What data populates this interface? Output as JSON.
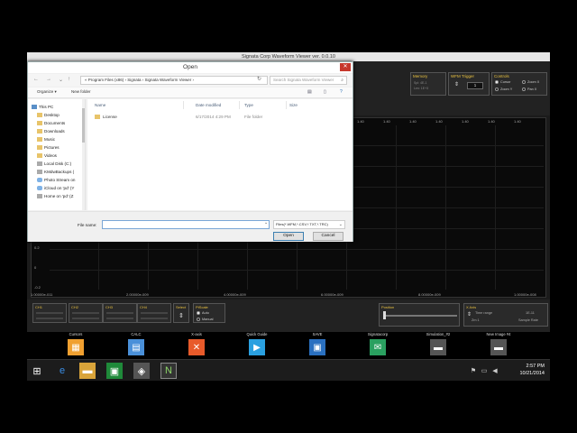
{
  "app": {
    "title": "Signata Corp Waveform Viewer ver. 0.0.10",
    "memory": {
      "title": "Memory",
      "line1": "Spl: 4E-1",
      "line2": "Len: 1E+3"
    },
    "wfm_trigger": {
      "title": "WFM Trigger",
      "value": "1"
    },
    "controls": {
      "title": "Controls",
      "opt1": "Cursor",
      "opt2": "Zoom X",
      "opt3": "Zoom Y",
      "opt4": "Pan X"
    },
    "plot": {
      "top_ticks": [
        "1.40",
        "1.40",
        "1.40",
        "1.40",
        "1.40",
        "1.40",
        "1.40"
      ],
      "bottom_ticks": [
        "1.00000e-011",
        "2.00000e-009",
        "4.00000e-009",
        "6.00000e-009",
        "8.00000e-009",
        "1.00000e-008"
      ],
      "yticks": [
        "0.2",
        "0",
        "-0.2"
      ]
    },
    "channels": [
      "CH1",
      "CH2",
      "CH3",
      "CH4"
    ],
    "select_label": "Select",
    "ptscale": {
      "title": "PtScale",
      "auto": "Auto",
      "manual": "Manual"
    },
    "position_label": "Position",
    "xaxis": {
      "title": "X Axis",
      "time_range": "Time range",
      "time_range_val": "1E-11",
      "sample_rate": "Sample Rate",
      "zoom": "Zm 1"
    }
  },
  "ribbon": [
    {
      "label": "Cursors",
      "icon": "cursors-icon",
      "glyph": "▦",
      "color": "#f0a030"
    },
    {
      "label": "CALC",
      "icon": "calculator-icon",
      "glyph": "▤",
      "color": "#4a90d9"
    },
    {
      "label": "X-axis",
      "icon": "x-axis-icon",
      "glyph": "✕",
      "color": "#e85a2a"
    },
    {
      "label": "Quick Guide",
      "icon": "quick-guide-icon",
      "glyph": "▶",
      "color": "#2aa0e0"
    },
    {
      "label": "SAVE",
      "icon": "save-icon",
      "glyph": "▣",
      "color": "#2a70c0"
    },
    {
      "label": "Signatacorp",
      "icon": "signatacorp-icon",
      "glyph": "✉",
      "color": "#2aa060"
    },
    {
      "label": "Simulation_#2",
      "icon": "simulation-icon",
      "glyph": "▬",
      "color": "#555"
    },
    {
      "label": "New Image #4",
      "icon": "new-image-icon",
      "glyph": "▬",
      "color": "#555"
    }
  ],
  "taskbar": {
    "time": "2:57 PM",
    "date": "10/21/2014"
  },
  "dialog": {
    "title": "Open",
    "close_glyph": "✕",
    "breadcrumb": "« Program Files (x86)  ›  Signata  ›  Signata Waveform Viewer  ›",
    "search_placeholder": "Search Signata Waveform Viewer",
    "organize": "Organize ▾",
    "new_folder": "New folder",
    "nav_items": [
      {
        "label": "This PC",
        "ico": "pc",
        "indent": 0
      },
      {
        "label": "Desktop",
        "ico": "folder",
        "indent": 1
      },
      {
        "label": "Documents",
        "ico": "folder",
        "indent": 1
      },
      {
        "label": "Downloads",
        "ico": "folder",
        "indent": 1
      },
      {
        "label": "Music",
        "ico": "folder",
        "indent": 1
      },
      {
        "label": "Pictures",
        "ico": "folder",
        "indent": 1
      },
      {
        "label": "Videos",
        "ico": "folder",
        "indent": 1
      },
      {
        "label": "Local Disk (C:)",
        "ico": "disk",
        "indent": 1
      },
      {
        "label": "KMdwBackups (",
        "ico": "disk",
        "indent": 1
      },
      {
        "label": "Photo Stream on",
        "ico": "cloud",
        "indent": 1
      },
      {
        "label": "iCloud on 'pd' (Y",
        "ico": "cloud",
        "indent": 1
      },
      {
        "label": "Home on 'pd' (Z",
        "ico": "disk",
        "indent": 1
      }
    ],
    "columns": {
      "name": "Name",
      "date": "Date modified",
      "type": "Type",
      "size": "Size"
    },
    "files": [
      {
        "name": "License",
        "date": "6/17/2014 4:29 PM",
        "type": "File folder",
        "size": ""
      }
    ],
    "filename_label": "File name:",
    "filename_value": "",
    "filetype": "Files(*.WFM,*.CSV,*.TXT,*.TRC)",
    "open_label": "Open",
    "cancel_label": "Cancel"
  }
}
